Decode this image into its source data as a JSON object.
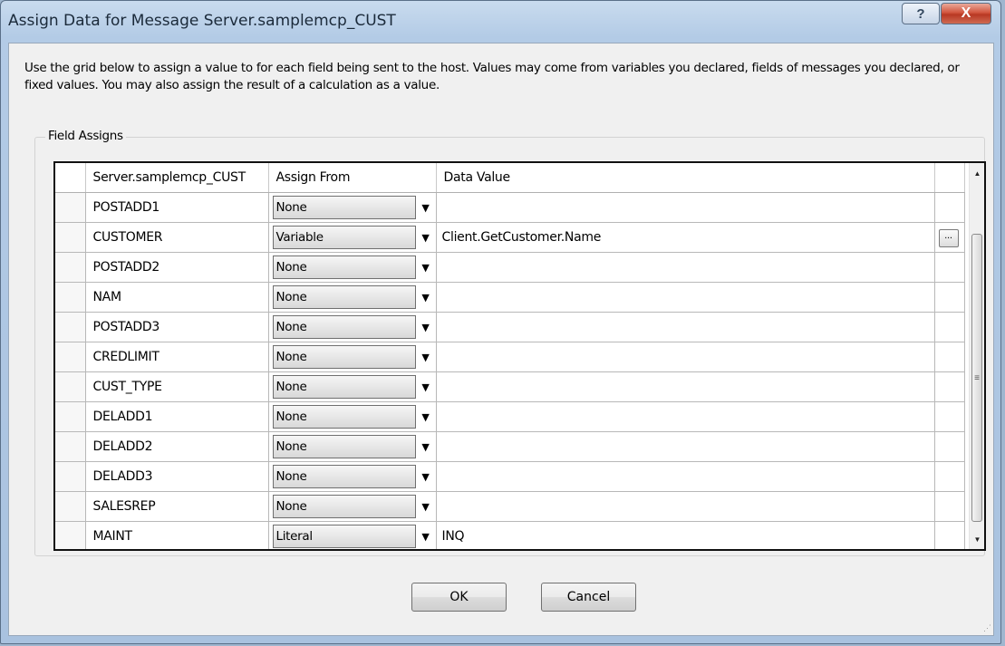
{
  "window": {
    "title": "Assign Data for Message Server.samplemcp_CUST",
    "help_label": "?",
    "close_label": "X"
  },
  "description": "Use the grid below to assign a value to for each field being sent to the host. Values may come from variables you declared, fields of messages you declared, or fixed values. You may also  assign the result of a calculation as a value.",
  "group": {
    "label": "Field Assigns"
  },
  "grid": {
    "columns": [
      "Server.samplemcp_CUST",
      "Assign From",
      "Data Value"
    ],
    "rows": [
      {
        "field": "POSTADD1",
        "assign_from": "None",
        "data_value": ""
      },
      {
        "field": "CUSTOMER",
        "assign_from": "Variable",
        "data_value": "Client.GetCustomer.Name",
        "has_ellipsis": true
      },
      {
        "field": "POSTADD2",
        "assign_from": "None",
        "data_value": ""
      },
      {
        "field": "NAM",
        "assign_from": "None",
        "data_value": ""
      },
      {
        "field": "POSTADD3",
        "assign_from": "None",
        "data_value": ""
      },
      {
        "field": "CREDLIMIT",
        "assign_from": "None",
        "data_value": ""
      },
      {
        "field": "CUST_TYPE",
        "assign_from": "None",
        "data_value": ""
      },
      {
        "field": "DELADD1",
        "assign_from": "None",
        "data_value": ""
      },
      {
        "field": "DELADD2",
        "assign_from": "None",
        "data_value": ""
      },
      {
        "field": "DELADD3",
        "assign_from": "None",
        "data_value": ""
      },
      {
        "field": "SALESREP",
        "assign_from": "None",
        "data_value": ""
      },
      {
        "field": "MAINT",
        "assign_from": "Literal",
        "data_value": "INQ"
      }
    ],
    "ellipsis_label": "...",
    "dropdown_icon": "chevron-down-icon"
  },
  "buttons": {
    "ok": "OK",
    "cancel": "Cancel"
  }
}
